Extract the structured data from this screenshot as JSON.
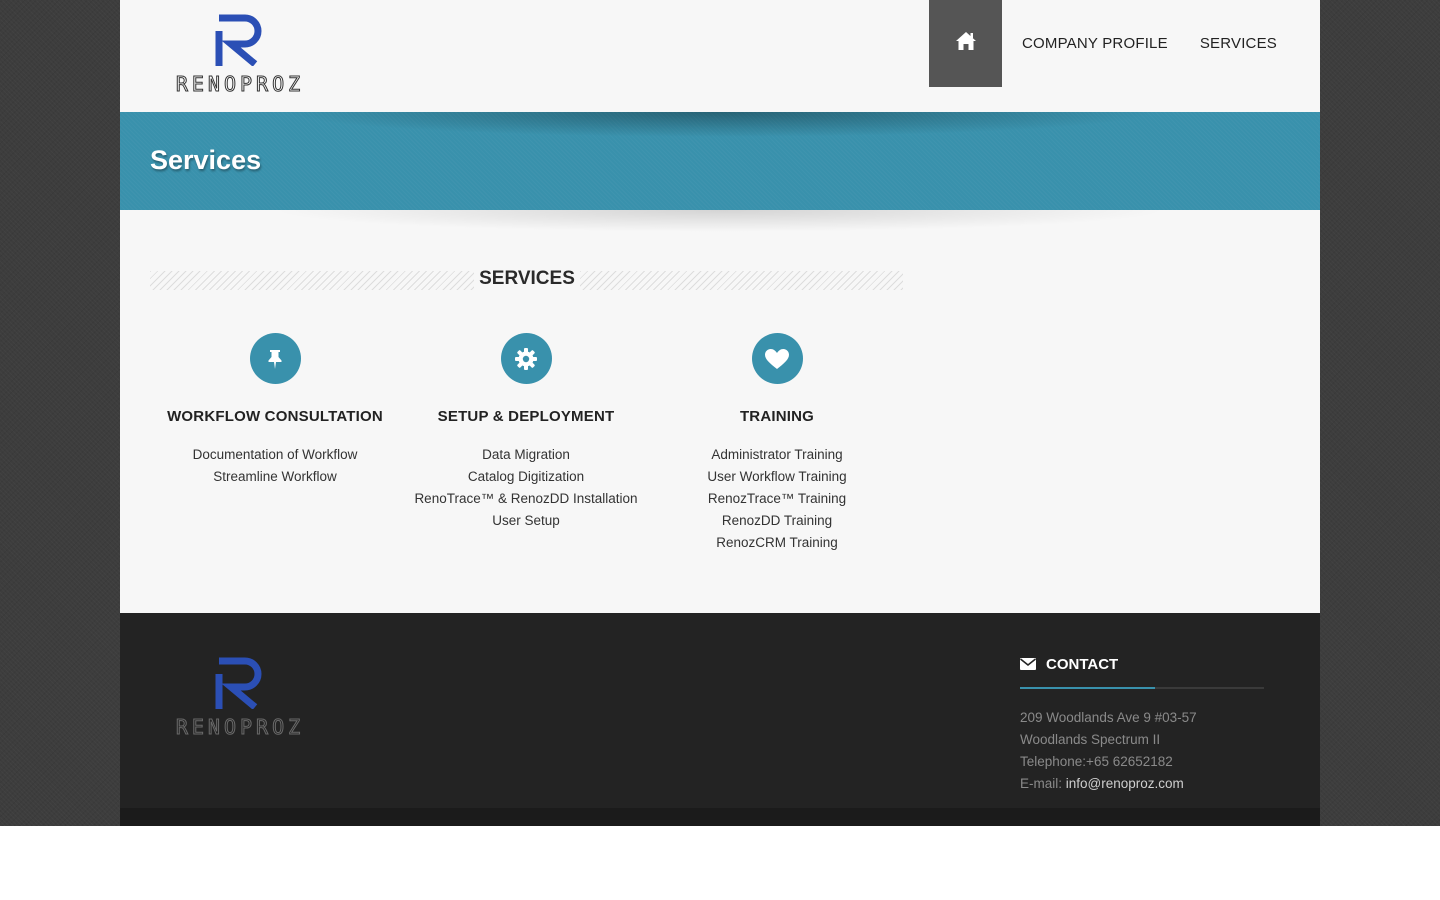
{
  "brand": {
    "logo_text": "RENOPROZ",
    "accent": "#3991ac",
    "logo_blue": "#2b4fb5"
  },
  "nav": {
    "home_icon": "home-icon",
    "items": [
      {
        "label": "COMPANY PROFILE"
      },
      {
        "label": "SERVICES"
      }
    ]
  },
  "banner": {
    "title": "Services"
  },
  "section": {
    "heading": "SERVICES"
  },
  "services": [
    {
      "icon": "pushpin-icon",
      "title": "WORKFLOW CONSULTATION",
      "items": [
        "Documentation of Workflow",
        "Streamline Workflow"
      ]
    },
    {
      "icon": "gear-icon",
      "title": "SETUP & DEPLOYMENT",
      "items": [
        "Data Migration",
        "Catalog Digitization",
        "RenoTrace™ & RenozDD Installation",
        "User Setup"
      ]
    },
    {
      "icon": "heart-icon",
      "title": "TRAINING",
      "items": [
        "Administrator Training",
        "User Workflow Training",
        "RenozTrace™ Training",
        "RenozDD Training",
        "RenozCRM Training"
      ]
    }
  ],
  "footer": {
    "logo_text": "RENOPROZ",
    "contact": {
      "icon": "envelope-icon",
      "title": "CONTACT",
      "address1": "209 Woodlands Ave 9 #03-57",
      "address2": "Woodlands Spectrum II",
      "telephone": "Telephone:+65 62652182",
      "email_label": "E-mail: ",
      "email": "info@renoproz.com"
    }
  }
}
